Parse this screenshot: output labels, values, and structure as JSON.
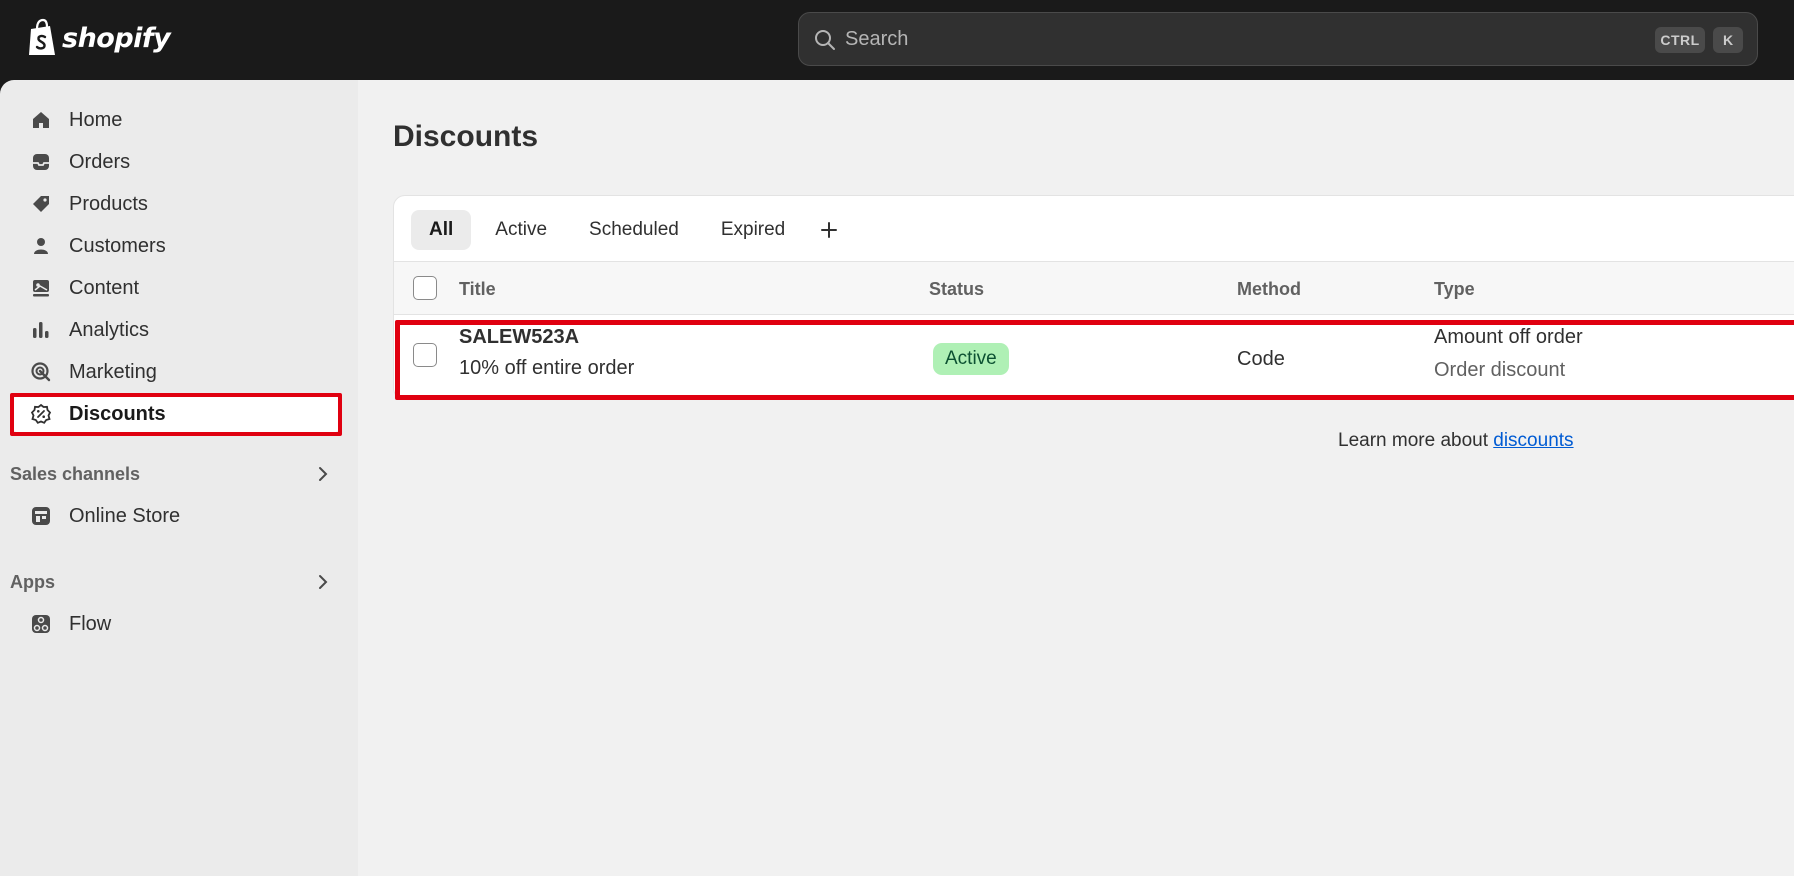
{
  "brand": {
    "name": "shopify"
  },
  "search": {
    "placeholder": "Search",
    "shortcut_ctrl": "CTRL",
    "shortcut_key": "K"
  },
  "sidebar": {
    "items": [
      {
        "label": "Home",
        "icon": "home-icon"
      },
      {
        "label": "Orders",
        "icon": "inbox-icon"
      },
      {
        "label": "Products",
        "icon": "tag-icon"
      },
      {
        "label": "Customers",
        "icon": "person-icon"
      },
      {
        "label": "Content",
        "icon": "image-icon"
      },
      {
        "label": "Analytics",
        "icon": "bar-chart-icon"
      },
      {
        "label": "Marketing",
        "icon": "target-icon"
      },
      {
        "label": "Discounts",
        "icon": "discount-icon",
        "active": true
      }
    ],
    "sales_channels": {
      "label": "Sales channels",
      "items": [
        {
          "label": "Online Store",
          "icon": "store-icon"
        }
      ]
    },
    "apps": {
      "label": "Apps",
      "items": [
        {
          "label": "Flow",
          "icon": "flow-icon"
        }
      ]
    }
  },
  "main": {
    "title": "Discounts",
    "tabs": [
      {
        "label": "All",
        "selected": true
      },
      {
        "label": "Active"
      },
      {
        "label": "Scheduled"
      },
      {
        "label": "Expired"
      },
      {
        "label": "+"
      }
    ],
    "columns": [
      "Title",
      "Status",
      "Method",
      "Type"
    ],
    "rows": [
      {
        "code": "SALEW523A",
        "summary": "10% off entire order",
        "status": "Active",
        "method": "Code",
        "type": "Amount off order",
        "type_detail": "Order discount"
      }
    ],
    "learn_more": {
      "prefix": "Learn more about ",
      "link": "discounts"
    }
  },
  "colors": {
    "topbar": "#1a1a1a",
    "sidebar": "#ebebeb",
    "main_bg": "#f1f1f1",
    "active_badge": "#aff0b5",
    "highlight": "#e00010",
    "link": "#005bd3"
  }
}
